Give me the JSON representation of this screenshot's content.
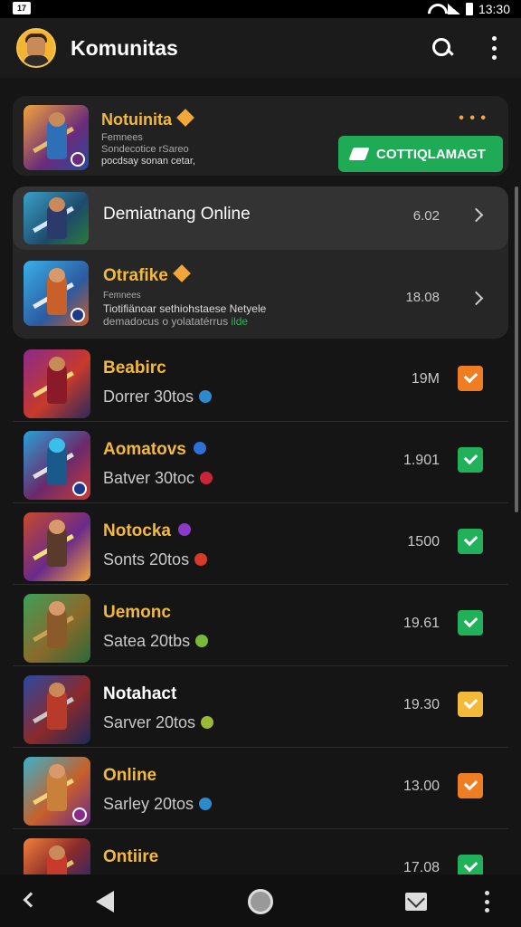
{
  "status_bar": {
    "left_badge": "17",
    "time": "13:30"
  },
  "app_bar": {
    "title": "Komunitas"
  },
  "featured": {
    "title": "Notuinita",
    "subtitle_lines": [
      "Femnees",
      "Sondecotice rSareo",
      "pocdsay sonan cetar,"
    ],
    "menu_dots": "• • •",
    "cta_label": "COTTIQLAMAGT"
  },
  "group": {
    "item1": {
      "title": "Demiatnang Online",
      "value": "6.02"
    },
    "item2": {
      "title": "Otrafike",
      "sub1": "Femnees",
      "sub2": "Tiotifiänoar sethiohstaese Netyele",
      "sub3": "demadocus o yolatatérrus",
      "sub3_green": "ilde",
      "value": "18.08"
    }
  },
  "rows": [
    {
      "title": "Beabirc",
      "sub": "Dorrer 30tos",
      "size": "19M",
      "btn": "orange",
      "title_white": false
    },
    {
      "title": "Aomatovs",
      "sub": "Batver 30toc",
      "size": "1.901",
      "btn": "green",
      "title_white": false
    },
    {
      "title": "Notocka",
      "sub": "Sonts 20tos",
      "size": "1500",
      "btn": "green",
      "title_white": false
    },
    {
      "title": "Uemonc",
      "sub": "Satea 20tbs",
      "size": "19.61",
      "btn": "green",
      "title_white": false
    },
    {
      "title": "Notahact",
      "sub": "Sarver 20tos",
      "size": "19.30",
      "btn": "yellow",
      "title_white": true
    },
    {
      "title": "Online",
      "sub": "Sarley 20tos",
      "size": "13.00",
      "btn": "orange",
      "title_white": false
    },
    {
      "title": "Ontiire",
      "sub": "",
      "size": "17.08",
      "btn": "green",
      "title_white": false
    }
  ],
  "colors": {
    "accent_gold": "#f3b93a",
    "accent_green": "#1faa55",
    "accent_orange": "#f07d22"
  }
}
